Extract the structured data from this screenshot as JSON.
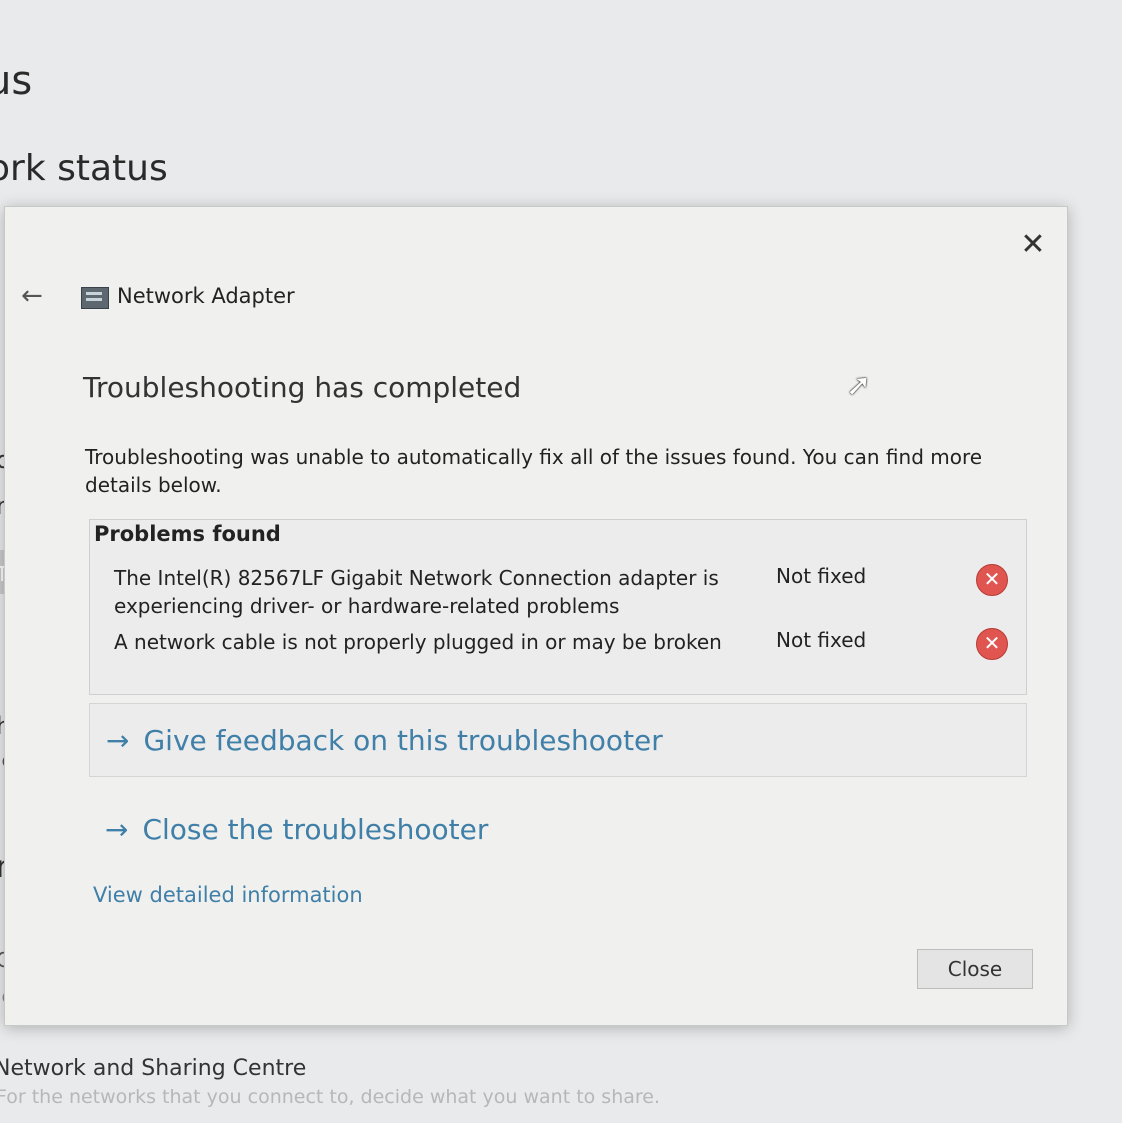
{
  "background": {
    "heading_fragment": "us",
    "subheading_fragment": "ork status",
    "left_fragments": [
      "o",
      "n",
      "Tr",
      "h",
      "ie",
      "n",
      "Ch",
      "ie"
    ],
    "sharing_centre_label": "Network and Sharing Centre",
    "sharing_centre_desc": "For the networks that you connect to, decide what you want to share."
  },
  "dialog": {
    "header_title": "Network Adapter",
    "title": "Troubleshooting has completed",
    "description": "Troubleshooting was unable to automatically fix all of the issues found. You can find more details below.",
    "problems_header": "Problems found",
    "problems": [
      {
        "description": "The Intel(R) 82567LF Gigabit Network Connection adapter is experiencing driver- or hardware-related problems",
        "status": "Not fixed"
      },
      {
        "description": "A network cable is not properly plugged in or may be broken",
        "status": "Not fixed"
      }
    ],
    "feedback_link": "Give feedback on this troubleshooter",
    "close_troubleshooter_link": "Close the troubleshooter",
    "detail_link": "View detailed information",
    "close_button": "Close"
  },
  "icons": {
    "back": "back-arrow-icon",
    "adapter": "network-adapter-icon",
    "close": "close-icon",
    "error": "error-icon",
    "link_arrow": "arrow-right-icon",
    "cursor": "mouse-pointer-icon"
  },
  "colors": {
    "link": "#3f7fa8",
    "error": "#e0554f",
    "dialog_bg": "#f0f0ee"
  }
}
